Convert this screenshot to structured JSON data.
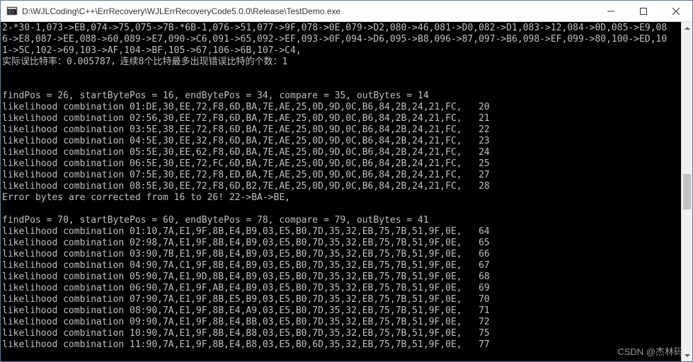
{
  "window": {
    "title": "D:\\WJLCoding\\C++\\ErrRecovery\\WJLErrRecoveryCode5.0.0\\Release\\TestDemo.exe"
  },
  "console": {
    "lines": [
      "2-*30-1,073->EB,074->75,075->7B-*6B-1,076->51,077->9F,078->0E,079->D2,080->46,081->D0,082->D1,083->12,084->0D,085->E9,08",
      "6->E8,087->EE,088->60,089->E7,090->C6,091->65,092->EF,093->0F,094->D6,095->B8,096->87,097->B6,098->EF,099->80,100->ED,10",
      "1->5C,102->69,103->AF,104->BF,105->67,106->6B,107->C4,",
      "实际误比特率：0.005787，连续8个比特最多出现错误比特的个数：1",
      "",
      "",
      "findPos = 26, startBytePos = 16, endBytePos = 34, compare = 35, outBytes = 14",
      "likelihood combination 01:DE,30,EE,72,F8,6D,BA,7E,AE,25,0D,9D,0C,B6,84,2B,24,21,FC,   20",
      "likelihood combination 02:56,30,EE,72,F8,6D,BA,7E,AE,25,0D,9D,0C,B6,84,2B,24,21,FC,   21",
      "likelihood combination 03:5E,38,EE,72,F8,6D,BA,7E,AE,25,0D,9D,0C,B6,84,2B,24,21,FC,   22",
      "likelihood combination 04:5E,30,EE,32,F8,6D,BA,7E,AE,25,0D,9D,0C,B6,84,2B,24,21,FC,   23",
      "likelihood combination 05:5E,30,EE,62,F8,6D,BA,7E,AE,25,0D,9D,0C,B6,84,2B,24,21,FC,   24",
      "likelihood combination 06:5E,30,EE,72,FC,6D,BA,7E,AE,25,0D,9D,0C,B6,84,2B,24,21,FC,   25",
      "likelihood combination 07:5E,30,EE,72,F8,ED,BA,7E,AE,25,0D,9D,0C,B6,84,2B,24,21,FC,   27",
      "likelihood combination 08:5E,30,EE,72,F8,6D,B2,7E,AE,25,0D,9D,0C,B6,84,2B,24,21,FC,   28",
      "Error bytes are corrected from 16 to 26! 22->BA->BE,",
      "",
      "findPos = 70, startBytePos = 60, endBytePos = 78, compare = 79, outBytes = 41",
      "likelihood combination 01:10,7A,E1,9F,8B,E4,B9,03,E5,B0,7D,35,32,EB,75,7B,51,9F,0E,   64",
      "likelihood combination 02:98,7A,E1,9F,8B,E4,B9,03,E5,B0,7D,35,32,EB,75,7B,51,9F,0E,   65",
      "likelihood combination 03:90,7B,E1,9F,8B,E4,B9,03,E5,B0,7D,35,32,EB,75,7B,51,9F,0E,   66",
      "likelihood combination 04:90,7A,C1,9F,8B,E4,B9,03,E5,B0,7D,35,32,EB,75,7B,51,9F,0E,   67",
      "likelihood combination 05:90,7A,E1,9D,8B,E4,B9,03,E5,B0,7D,35,32,EB,75,7B,51,9F,0E,   68",
      "likelihood combination 06:90,7A,E1,9F,AB,E4,B9,03,E5,B0,7D,35,32,EB,75,7B,51,9F,0E,   69",
      "likelihood combination 07:90,7A,E1,9F,8B,E5,B9,03,E5,B0,7D,35,32,EB,75,7B,51,9F,0E,   70",
      "likelihood combination 08:90,7A,E1,9F,8B,E4,A9,03,E5,B0,7D,35,32,EB,75,7B,51,9F,0E,   71",
      "likelihood combination 09:90,7A,E1,9F,8B,E4,BB,03,E5,B0,7D,35,32,EB,75,7B,51,9F,0E,   72",
      "likelihood combination 10:90,7A,E1,9F,8B,E4,B8,03,E5,B0,7D,35,32,EB,75,7B,51,9F,0E,   75",
      "likelihood combination 11:90,7A,E1,9F,8B,E4,B8,03,E5,B0,6D,35,32,EB,75,7B,51,9F,0E,   77"
    ]
  },
  "watermark": "CSDN @杰林码"
}
